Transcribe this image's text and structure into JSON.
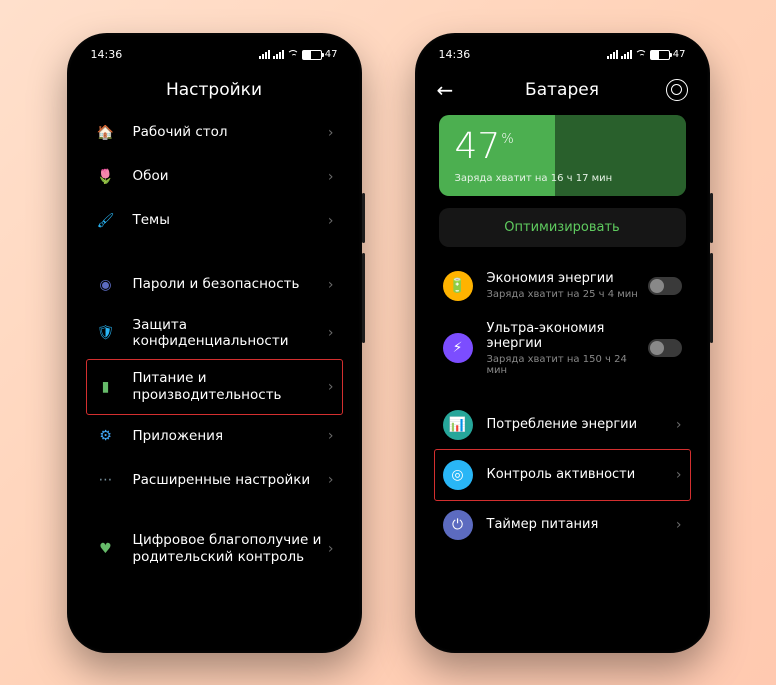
{
  "statusbar": {
    "time": "14:36",
    "battery_pct": "47"
  },
  "left": {
    "title": "Настройки",
    "items": [
      {
        "label": "Рабочий стол",
        "icon": "🏠",
        "color": "#7e57c2"
      },
      {
        "label": "Обои",
        "icon": "🌷",
        "color": "#ec407a"
      },
      {
        "label": "Темы",
        "icon": "🖌",
        "color": "#29b6f6"
      }
    ],
    "items2": [
      {
        "label": "Пароли и безопасность",
        "icon": "◉",
        "color": "#5c6bc0"
      },
      {
        "label": "Защита конфиденциальности",
        "icon": "🛡",
        "color": "#29b6f6"
      },
      {
        "label": "Питание и производительность",
        "icon": "▮",
        "color": "#66bb6a",
        "hl": true
      },
      {
        "label": "Приложения",
        "icon": "⚙",
        "color": "#42a5f5"
      },
      {
        "label": "Расширенные настройки",
        "icon": "⋯",
        "color": "#78909c"
      }
    ],
    "items3": [
      {
        "label": "Цифровое благополучие и родительский контроль",
        "icon": "♥",
        "color": "#66bb6a"
      }
    ]
  },
  "right": {
    "title": "Батарея",
    "batt_num": "47",
    "batt_unit": "%",
    "batt_sub": "Заряда хватит на 16 ч 17 мин",
    "optimize": "Оптимизировать",
    "modes": [
      {
        "title": "Экономия энергии",
        "sub": "Заряда хватит на 25 ч 4 мин",
        "bg": "#ffb300",
        "icon": "🔋"
      },
      {
        "title": "Ультра-экономия энергии",
        "sub": "Заряда хватит на 150 ч 24 мин",
        "bg": "#7c4dff",
        "icon": "⚡"
      }
    ],
    "links": [
      {
        "title": "Потребление энергии",
        "bg": "#26a69a",
        "icon": "📊"
      },
      {
        "title": "Контроль активности",
        "bg": "#29b6f6",
        "icon": "◎",
        "hl": true
      },
      {
        "title": "Таймер питания",
        "bg": "#5c6bc0",
        "icon": "⏻"
      }
    ]
  }
}
